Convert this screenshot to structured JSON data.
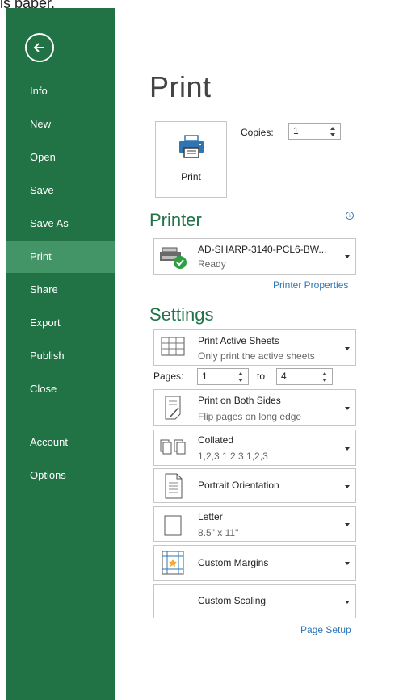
{
  "caption": "is paper.",
  "nav": {
    "back": "back",
    "items": [
      "Info",
      "New",
      "Open",
      "Save",
      "Save As",
      "Print",
      "Share",
      "Export",
      "Publish",
      "Close",
      "Account",
      "Options"
    ],
    "active": "Print"
  },
  "page": {
    "title": "Print"
  },
  "print_button": {
    "label": "Print",
    "icon": "printer-icon"
  },
  "copies": {
    "label": "Copies:",
    "value": "1"
  },
  "printer": {
    "heading": "Printer",
    "name": "AD-SHARP-3140-PCL6-BW...",
    "status": "Ready",
    "properties_link": "Printer Properties",
    "info_icon": "info-icon",
    "icon": "printer-ready-icon"
  },
  "settings": {
    "heading": "Settings",
    "sheets": {
      "line1": "Print Active Sheets",
      "line2": "Only print the active sheets"
    },
    "pages": {
      "label": "Pages:",
      "from": "1",
      "to_label": "to",
      "to": "4"
    },
    "sides": {
      "line1": "Print on Both Sides",
      "line2": "Flip pages on long edge"
    },
    "collate": {
      "line1": "Collated",
      "line2": "1,2,3   1,2,3   1,2,3"
    },
    "orientation": {
      "line1": "Portrait Orientation"
    },
    "paper": {
      "line1": "Letter",
      "line2": "8.5\" x 11\""
    },
    "margins": {
      "line1": "Custom Margins"
    },
    "scaling": {
      "line1": "Custom Scaling"
    },
    "page_setup_link": "Page Setup"
  },
  "colors": {
    "sidebar": "#217346",
    "active_nav": "#439467",
    "accent": "#217346",
    "link": "#2e75b6"
  }
}
